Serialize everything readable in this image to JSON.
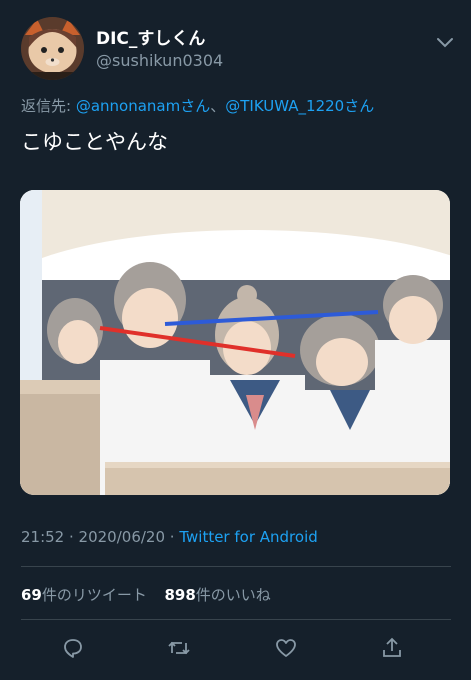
{
  "tweet": {
    "display_name": "DIC_すしくん",
    "handle": "@sushikun0304",
    "reply_prefix": "返信先: ",
    "reply_mention_1": "@annonanamさん",
    "reply_separator": "、",
    "reply_mention_2": "@TIKUWA_1220さん",
    "text": "こゆことやんな",
    "time": "21:52",
    "dot": " · ",
    "date": "2020/06/20",
    "source": "Twitter for Android",
    "retweet_count": "69",
    "retweet_label": "件のリツイート",
    "like_count": "898",
    "like_label": "件のいいね"
  },
  "colors": {
    "background": "#15202b",
    "secondary_text": "#8899a6",
    "link": "#1da1f2",
    "divider": "#38444d",
    "line_blue": "#2d5bd8",
    "line_red": "#e0302a"
  },
  "icons": [
    "chevron-down-icon",
    "reply-icon",
    "retweet-icon",
    "like-icon",
    "share-icon"
  ]
}
